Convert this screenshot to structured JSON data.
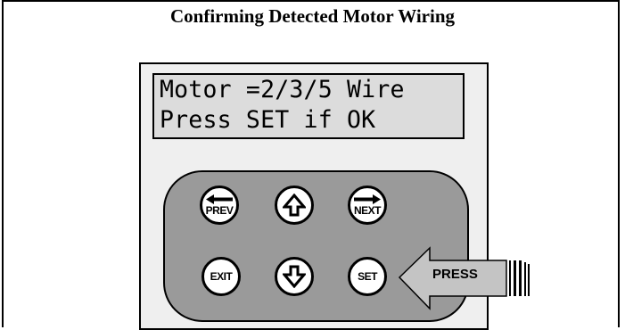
{
  "title": "Confirming Detected Motor Wiring",
  "display": {
    "line1": "Motor =2/3/5 Wire",
    "line2": "Press SET if OK"
  },
  "keys": {
    "prev": "PREV",
    "up": "",
    "next": "NEXT",
    "exit": "EXIT",
    "down": "",
    "set": "SET"
  },
  "callout": {
    "label": "PRESS"
  },
  "colors": {
    "panel": "#efefef",
    "display": "#dcdcdc",
    "keypad": "#9a9a9a",
    "arrow": "#c4c4c4"
  }
}
